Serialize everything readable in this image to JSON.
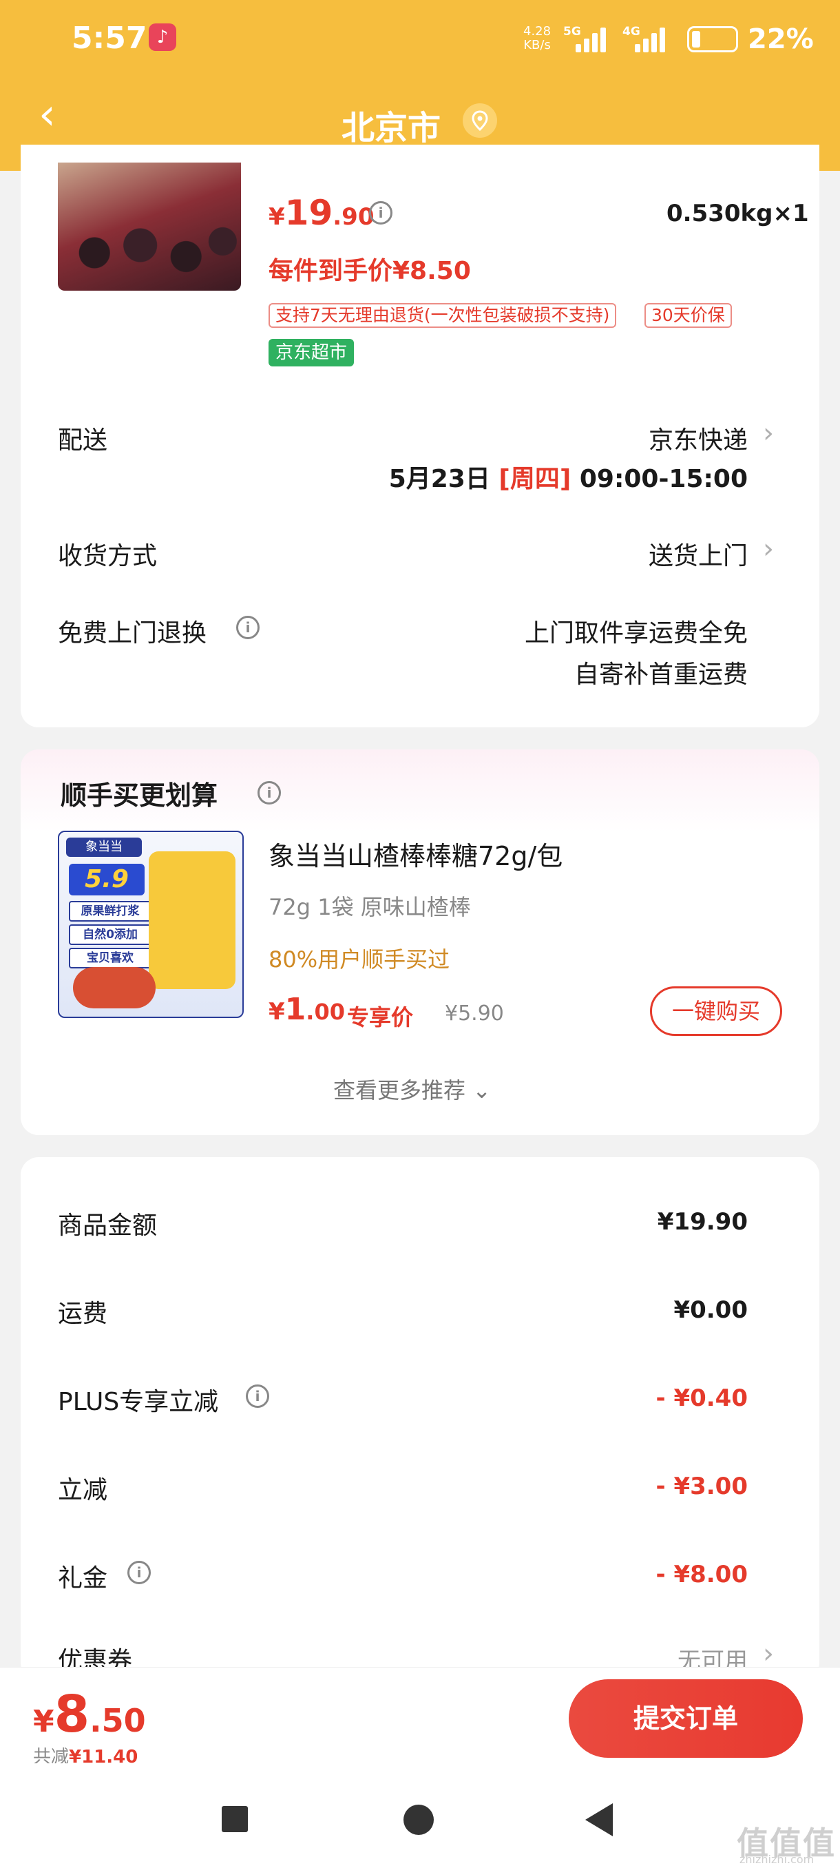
{
  "status_bar": {
    "time": "5:57",
    "net_speed_value": "4.28",
    "net_speed_unit": "KB/s",
    "net1_label": "5G",
    "net2_label": "4G",
    "battery_pct": "22%"
  },
  "header": {
    "title": "北京市"
  },
  "product": {
    "price_currency": "¥",
    "price_int": "19",
    "price_dec": ".90",
    "weight_qty": "0.530kg×1",
    "each_price": "每件到手价¥8.50",
    "tags": [
      "支持7天无理由退货(一次性包装破损不支持)",
      "30天价保"
    ],
    "store_tag": "京东超市"
  },
  "delivery": {
    "label": "配送",
    "carrier": "京东快递",
    "date": "5月23日",
    "weekday": "[周四]",
    "time_window": "09:00-15:00"
  },
  "receive": {
    "label": "收货方式",
    "value": "送货上门"
  },
  "free_return": {
    "label": "免费上门退换",
    "line1": "上门取件享运费全免",
    "line2": "自寄补首重运费"
  },
  "recommend": {
    "title": "顺手买更划算",
    "image_texts": {
      "brand": "象当当",
      "price": "5.9",
      "tags": [
        "原果鲜打浆",
        "自然0添加",
        "宝贝喜欢"
      ]
    },
    "name": "象当当山楂棒棒糖72g/包",
    "spec": "72g 1袋 原味山楂棒",
    "social": "80%用户顺手买过",
    "price_currency": "¥",
    "price_int": "1",
    "price_dec": ".00",
    "exclusive_label": "专享价",
    "original_price": "¥5.90",
    "buy_button": "一键购买",
    "more_label": "查看更多推荐",
    "more_icon": "chevron-down-icon"
  },
  "summary": {
    "items": [
      {
        "label": "商品金额",
        "value": "¥19.90"
      },
      {
        "label": "运费",
        "value": "¥0.00"
      },
      {
        "label": "PLUS专享立减",
        "value": "- ¥0.40"
      },
      {
        "label": "立减",
        "value": "- ¥3.00"
      },
      {
        "label": "礼金",
        "value": "- ¥8.00"
      },
      {
        "label": "优惠券",
        "value": "无可用"
      }
    ]
  },
  "bottom_bar": {
    "total_currency": "¥",
    "total_int": "8",
    "total_dec": ".50",
    "discount_label": "共减",
    "discount_value": "¥11.40",
    "submit_label": "提交订单"
  },
  "watermark": {
    "text": "值值值",
    "url": "zhizhizhi.com"
  },
  "colors": {
    "header_bg": "#f6be3e",
    "accent_red": "#e53a2b",
    "store_green": "#2fb160",
    "social_orange": "#d08a24"
  }
}
